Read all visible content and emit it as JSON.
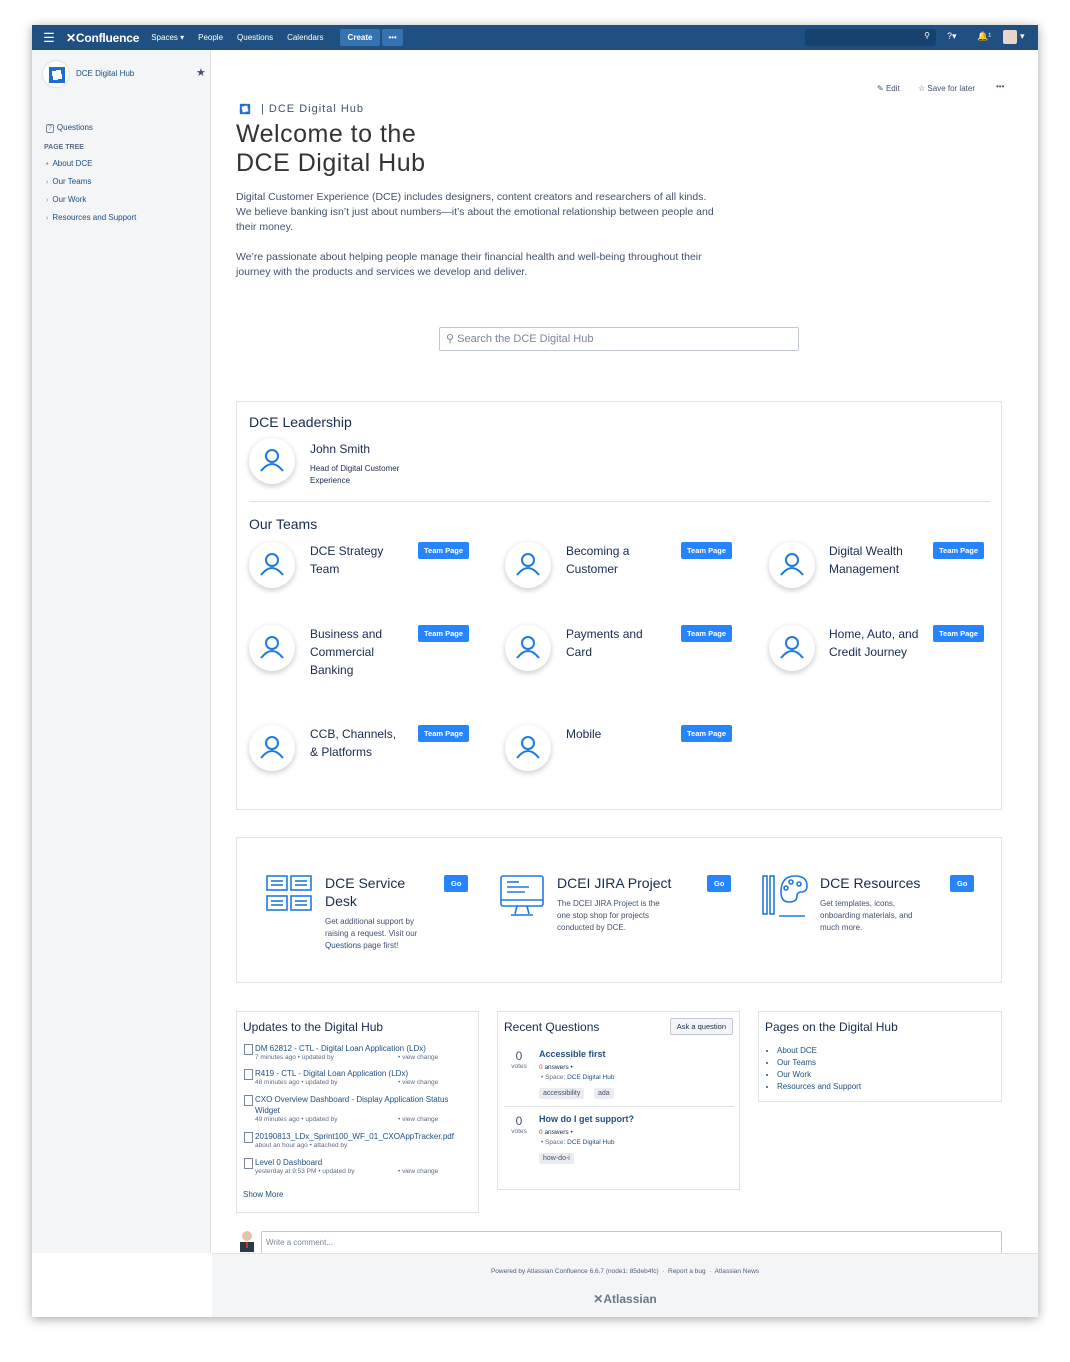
{
  "topnav": {
    "logo": "Confluence",
    "links": [
      "Spaces ▾",
      "People",
      "Questions",
      "Calendars"
    ],
    "create": "Create",
    "more": "•••",
    "help": "?▾",
    "notif": "🔔¹"
  },
  "sidebar": {
    "space_name": "DCE Digital Hub",
    "questions": "Questions",
    "page_tree_label": "PAGE TREE",
    "items": [
      "About DCE",
      "Our Teams",
      "Our Work",
      "Resources and Support"
    ]
  },
  "page": {
    "edit": "Edit",
    "save_later": "Save for later",
    "more": "•••",
    "breadcrumb": "| DCE Digital Hub",
    "title_line1": "Welcome to the",
    "title_line2": "DCE Digital Hub",
    "intro1": "Digital Customer Experience (DCE) includes designers, content creators and researchers of all kinds. We believe banking isn’t just about numbers—it’s about the emotional relationship between people and their money.",
    "intro2": "We’re passionate about helping people manage their financial health and well-being throughout their journey with the products and services we develop and deliver.",
    "search_placeholder": "Search the DCE Digital Hub"
  },
  "leadership": {
    "title": "DCE Leadership",
    "name": "John Smith",
    "role": "Head of Digital Customer Experience"
  },
  "teams": {
    "title": "Our Teams",
    "button": "Team Page",
    "items": [
      "DCE Strategy Team",
      "Becoming a Customer",
      "Digital Wealth Management",
      "Business and Commercial Banking",
      "Payments and Card",
      "Home, Auto, and Credit Journey",
      "CCB, Channels, & Platforms",
      "Mobile"
    ]
  },
  "resources": {
    "go": "Go",
    "service_desk": {
      "title": "DCE Service Desk",
      "desc": "Get additional support by raising a request. Visit our",
      "link": "Questions",
      "desc_end": "page first!"
    },
    "jira": {
      "title": "DCEI JIRA Project",
      "desc": "The DCEI JIRA Project is the one stop shop for projects conducted by DCE."
    },
    "dce_resources": {
      "title": "DCE Resources",
      "desc": "Get templates, icons, onboarding materials, and much more."
    }
  },
  "updates": {
    "title": "Updates to the Digital Hub",
    "items": [
      {
        "link": "DM 62812 - CTL - Digital Loan Application (LDx)",
        "meta": "7 minutes ago • updated by",
        "action": "• view change"
      },
      {
        "link": "R419 - CTL - Digital Loan Application (LDx)",
        "meta": "48 minutes ago • updated by",
        "action": "• view change"
      },
      {
        "link": "CXO Overview Dashboard - Display Application Status Widget",
        "meta": "49 minutes ago • updated by",
        "action": "• view change"
      },
      {
        "link": "20190813_LDx_Sprint100_WF_01_CXOAppTracker.pdf",
        "meta": "about an hour ago • attached by",
        "action": ""
      },
      {
        "link": "Level 0 Dashboard",
        "meta": "yesterday at 9:53 PM • updated by",
        "action": "• view change"
      }
    ],
    "show_more": "Show More"
  },
  "questions": {
    "title": "Recent Questions",
    "ask": "Ask a question",
    "votes_label": "votes",
    "items": [
      {
        "votes": "0",
        "title": "Accessible first",
        "answers_num": "0",
        "answers_label": "answers •",
        "space_prefix": "• Space:",
        "space": "DCE Digital Hub",
        "tags": [
          "accessibility",
          "ada"
        ]
      },
      {
        "votes": "0",
        "title": "How do I get support?",
        "answers_num": "0",
        "answers_label": "answers •",
        "space_prefix": "• Space:",
        "space": "DCE Digital Hub",
        "tags": [
          "how-do-i"
        ]
      }
    ]
  },
  "pages": {
    "title": "Pages on the Digital Hub",
    "items": [
      "About DCE",
      "Our Teams",
      "Our Work",
      "Resources and Support"
    ]
  },
  "comment": {
    "placeholder": "Write a comment..."
  },
  "footer": {
    "powered": "Powered by Atlassian Confluence 6.6.7 (node1: 85deb4fc)",
    "report": "Report a bug",
    "news": "Atlassian News",
    "logo": "Atlassian"
  },
  "colors": {
    "nav": "#205081",
    "button": "#2684ff",
    "link": "#205081",
    "icon_blue": "#1f7ae0"
  }
}
